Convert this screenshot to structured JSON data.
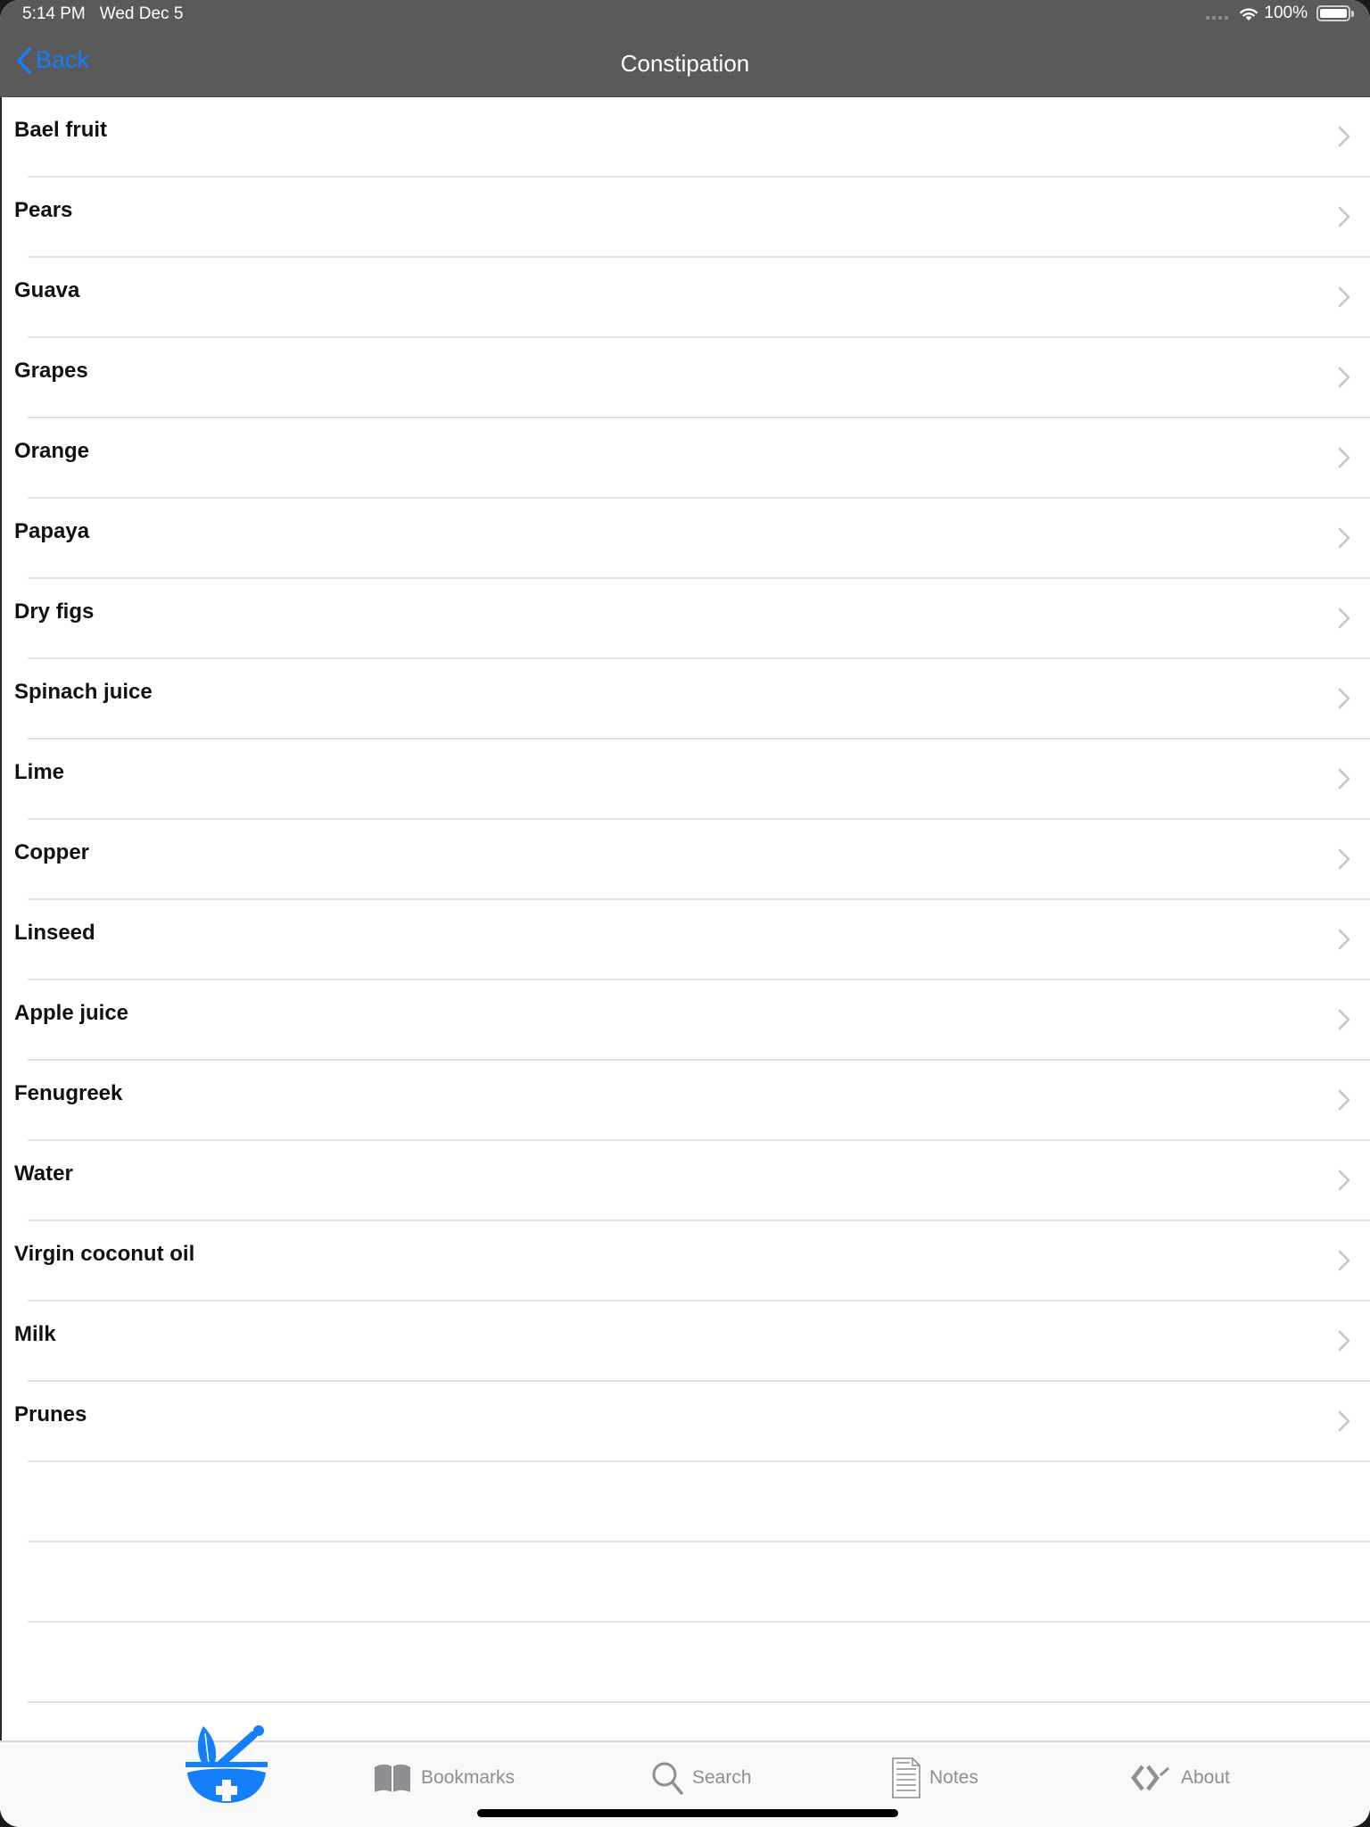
{
  "status_bar": {
    "time": "5:14 PM",
    "date": "Wed Dec 5",
    "battery": "100%",
    "icons": [
      "signal-dots-icon",
      "wifi-icon",
      "battery-icon"
    ]
  },
  "nav": {
    "back_label": "Back",
    "title": "Constipation",
    "accent_color": "#147efb"
  },
  "list": {
    "items": [
      {
        "label": "Bael fruit"
      },
      {
        "label": "Pears"
      },
      {
        "label": "Guava"
      },
      {
        "label": "Grapes"
      },
      {
        "label": "Orange"
      },
      {
        "label": "Papaya"
      },
      {
        "label": "Dry figs"
      },
      {
        "label": "Spinach juice"
      },
      {
        "label": "Lime"
      },
      {
        "label": "Copper"
      },
      {
        "label": "Linseed"
      },
      {
        "label": "Apple juice"
      },
      {
        "label": "Fenugreek"
      },
      {
        "label": "Water"
      },
      {
        "label": "Virgin coconut oil"
      },
      {
        "label": "Milk"
      },
      {
        "label": "Prunes"
      }
    ],
    "empty_rows": 3
  },
  "tabbar": {
    "tabs": [
      {
        "id": "home",
        "label": "",
        "icon": "mortar-pestle-leaf-icon",
        "active": true
      },
      {
        "id": "bookmarks",
        "label": "Bookmarks",
        "icon": "book-icon"
      },
      {
        "id": "search",
        "label": "Search",
        "icon": "magnifier-icon"
      },
      {
        "id": "notes",
        "label": "Notes",
        "icon": "document-icon"
      },
      {
        "id": "about",
        "label": "About",
        "icon": "code-brackets-icon"
      }
    ],
    "active_color": "#147efb",
    "inactive_color": "#8e8e93"
  }
}
